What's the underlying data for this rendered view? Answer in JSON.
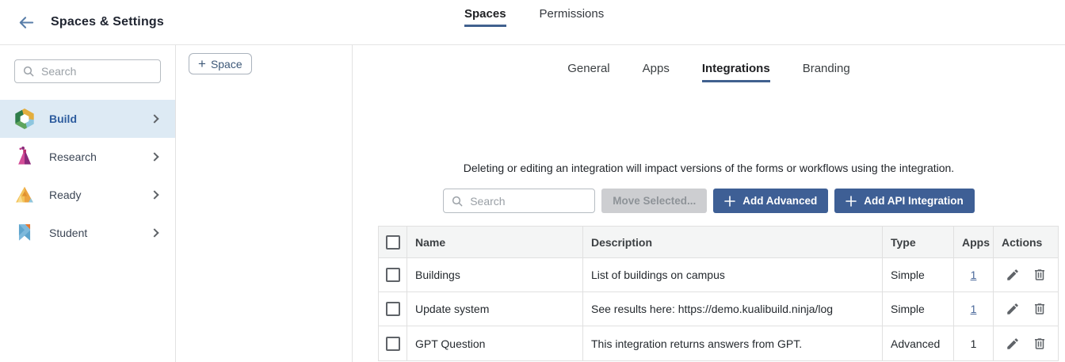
{
  "header": {
    "title": "Spaces & Settings",
    "tabs": [
      {
        "label": "Spaces",
        "active": true
      },
      {
        "label": "Permissions",
        "active": false
      }
    ]
  },
  "sidebar": {
    "search_placeholder": "Search",
    "items": [
      {
        "label": "Build",
        "icon": "build-hexagon-icon",
        "selected": true
      },
      {
        "label": "Research",
        "icon": "research-flask-icon",
        "selected": false
      },
      {
        "label": "Ready",
        "icon": "ready-mountain-icon",
        "selected": false
      },
      {
        "label": "Student",
        "icon": "student-bookmark-icon",
        "selected": false
      }
    ]
  },
  "space_panel": {
    "add_space_plus": "+",
    "add_space_label": "Space"
  },
  "main": {
    "tabs": [
      {
        "label": "General",
        "active": false
      },
      {
        "label": "Apps",
        "active": false
      },
      {
        "label": "Integrations",
        "active": true
      },
      {
        "label": "Branding",
        "active": false
      }
    ],
    "notice": "Deleting or editing an integration will impact versions of the forms or workflows using the integration.",
    "controls": {
      "search_placeholder": "Search",
      "move_selected_label": "Move Selected...",
      "add_advanced_label": "Add Advanced",
      "add_api_label": "Add API Integration"
    },
    "table": {
      "columns": [
        "Name",
        "Description",
        "Type",
        "Apps",
        "Actions"
      ],
      "rows": [
        {
          "name": "Buildings",
          "description": "List of buildings on campus",
          "type": "Simple",
          "apps": "1",
          "apps_is_link": true
        },
        {
          "name": "Update system",
          "description": "See results here: https://demo.kualibuild.ninja/log",
          "type": "Simple",
          "apps": "1",
          "apps_is_link": true
        },
        {
          "name": "GPT Question",
          "description": "This integration returns answers from GPT.",
          "type": "Advanced",
          "apps": "1",
          "apps_is_link": false
        }
      ]
    }
  },
  "icons": [
    "back-arrow-icon",
    "search-icon",
    "chevron-right-icon",
    "plus-icon",
    "edit-pencil-icon",
    "delete-trash-icon"
  ],
  "colors": {
    "primary_button": "#3e5f95",
    "tab_underline": "#41618f",
    "selected_item_bg": "#ddeaf4",
    "link": "#4a689a",
    "disabled_button_bg": "#cdced1"
  }
}
